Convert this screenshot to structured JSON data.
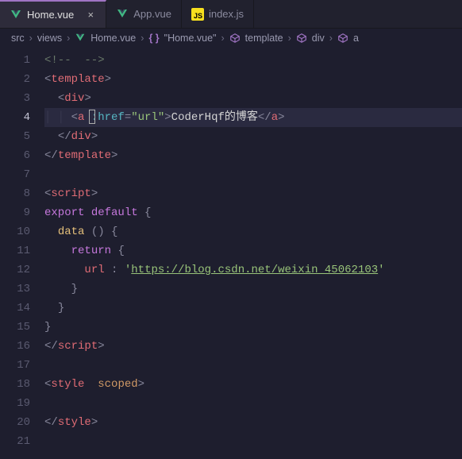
{
  "tabs": [
    {
      "label": "Home.vue",
      "icon": "vue",
      "active": true,
      "dirty": false
    },
    {
      "label": "App.vue",
      "icon": "vue",
      "active": false,
      "dirty": false
    },
    {
      "label": "index.js",
      "icon": "js",
      "active": false,
      "dirty": false
    }
  ],
  "breadcrumbs": {
    "items": [
      {
        "label": "src",
        "icon": null
      },
      {
        "label": "views",
        "icon": null
      },
      {
        "label": "Home.vue",
        "icon": "vue"
      },
      {
        "label": "\"Home.vue\"",
        "icon": "braces"
      },
      {
        "label": "template",
        "icon": "cube"
      },
      {
        "label": "div",
        "icon": "cube"
      },
      {
        "label": "a",
        "icon": "cube"
      }
    ]
  },
  "editor": {
    "line_count": 21,
    "active_line": 4,
    "cursor_col_after": "<a "
  },
  "code": {
    "l1_comment": "<!--  -->",
    "template_open": "template",
    "div_open": "div",
    "a_tag": "a",
    "a_bind_attr": ":href",
    "a_bind_val": "\"url\"",
    "a_text": "CoderHqf的博客",
    "div_close": "div",
    "template_close": "template",
    "script_open": "script",
    "export": "export",
    "default": "default",
    "data_fn": "data",
    "return": "return",
    "url_key": "url",
    "url_val": "https://blog.csdn.net/weixin_45062103",
    "script_close": "script",
    "style_open": "style",
    "scoped": "scoped",
    "style_close": "style"
  }
}
